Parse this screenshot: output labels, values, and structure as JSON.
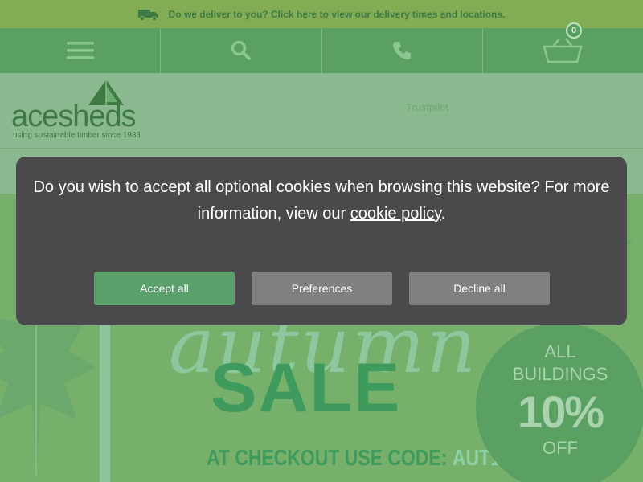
{
  "delivery_banner": {
    "text": "Do we deliver to you? Click here to view our delivery times and locations.",
    "icon": "truck-icon"
  },
  "navbar": {
    "items": [
      {
        "icon": "menu-icon"
      },
      {
        "icon": "search-icon"
      },
      {
        "icon": "phone-icon"
      },
      {
        "icon": "basket-icon"
      }
    ],
    "basket_count": "0"
  },
  "header": {
    "logo_ace": "ace",
    "logo_sheds": "sheds",
    "logo_tagline": "using sustainable timber since 1988",
    "trustpilot": "Trustpilot"
  },
  "hero": {
    "script_text": "autumn",
    "sale_text": "SALE",
    "code_label": "AT CHECKOUT USE CODE:",
    "code": "AUT10",
    "badge_line1": "ALL",
    "badge_line2": "BUILDINGS",
    "badge_percent": "10%",
    "badge_line4": "OFF"
  },
  "cookie_banner": {
    "message_prefix": "Do you wish to accept all optional cookies when browsing this website? For more information, view our ",
    "link_text": "cookie policy",
    "message_suffix": ".",
    "accept_label": "Accept all",
    "preferences_label": "Preferences",
    "decline_label": "Decline all"
  },
  "colors": {
    "brand_green": "#5aa062",
    "banner_green": "#82ad55",
    "modal_bg": "#4a4a4d",
    "accept_button": "#5aa06a",
    "neutral_button": "#808080"
  }
}
